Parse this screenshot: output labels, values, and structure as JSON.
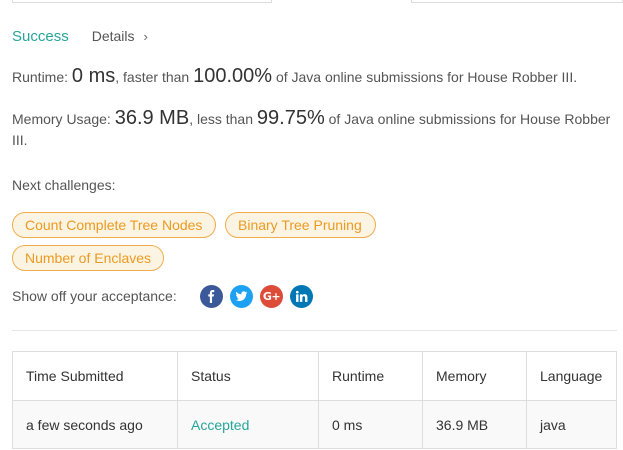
{
  "status": {
    "result": "Success",
    "details_label": "Details",
    "chevron": "›"
  },
  "runtime": {
    "label": "Runtime: ",
    "value": "0 ms",
    "mid": ", faster than ",
    "percent": "100.00%",
    "suffix": " of Java online submissions for House Robber III."
  },
  "memory": {
    "label": "Memory Usage: ",
    "value": "36.9 MB",
    "mid": ", less than ",
    "percent": "99.75%",
    "suffix": " of Java online submissions for House Robber III."
  },
  "next_challenges": {
    "label": "Next challenges:",
    "items": [
      "Count Complete Tree Nodes",
      "Binary Tree Pruning",
      "Number of Enclaves"
    ]
  },
  "share": {
    "label": "Show off your acceptance:",
    "icons": [
      "facebook-icon",
      "twitter-icon",
      "google-plus-icon",
      "linkedin-icon"
    ],
    "gp_text": "G+"
  },
  "colors": {
    "success": "#26a69a",
    "tag_border": "#f0ad4e",
    "tag_text": "#ec9a22",
    "facebook": "#3b5998",
    "twitter": "#1da1f2",
    "google_plus": "#dd4b39",
    "linkedin": "#0077b5"
  },
  "table": {
    "headers": [
      "Time Submitted",
      "Status",
      "Runtime",
      "Memory",
      "Language"
    ],
    "rows": [
      [
        "a few seconds ago",
        "Accepted",
        "0 ms",
        "36.9 MB",
        "java"
      ]
    ]
  }
}
